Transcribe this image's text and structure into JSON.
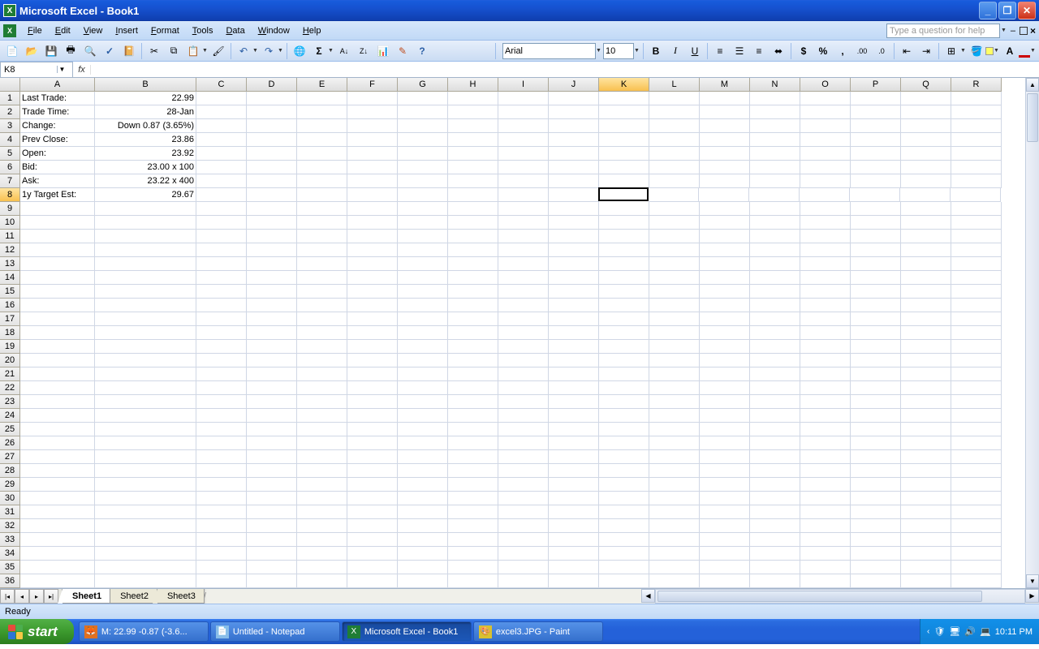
{
  "title": "Microsoft Excel - Book1",
  "menus": [
    "File",
    "Edit",
    "View",
    "Insert",
    "Format",
    "Tools",
    "Data",
    "Window",
    "Help"
  ],
  "helpbox": "Type a question for help",
  "namebox": "K8",
  "formula": "",
  "font": {
    "name": "Arial",
    "size": "10"
  },
  "columns": [
    "A",
    "B",
    "C",
    "D",
    "E",
    "F",
    "G",
    "H",
    "I",
    "J",
    "K",
    "L",
    "M",
    "N",
    "O",
    "P",
    "Q",
    "R"
  ],
  "colWidths": {
    "A": 92,
    "B": 125,
    "default": 62
  },
  "selectedCol": "K",
  "selectedRow": 8,
  "activeCell": "K8",
  "rows": [
    {
      "n": 1,
      "A": "Last Trade:",
      "B": "22.99",
      "Balign": "right"
    },
    {
      "n": 2,
      "A": "Trade Time:",
      "B": "28-Jan",
      "Balign": "right"
    },
    {
      "n": 3,
      "A": "Change:",
      "B": "Down 0.87 (3.65%)",
      "Balign": "right"
    },
    {
      "n": 4,
      "A": "Prev Close:",
      "B": "23.86",
      "Balign": "right"
    },
    {
      "n": 5,
      "A": "Open:",
      "B": "23.92",
      "Balign": "right"
    },
    {
      "n": 6,
      "A": "Bid:",
      "B": "23.00 x 100",
      "Balign": "right"
    },
    {
      "n": 7,
      "A": "Ask:",
      "B": "23.22 x 400",
      "Balign": "right"
    },
    {
      "n": 8,
      "A": "1y Target Est:",
      "B": "29.67",
      "Balign": "right"
    }
  ],
  "totalRows": 36,
  "sheets": {
    "active": "Sheet1",
    "list": [
      "Sheet1",
      "Sheet2",
      "Sheet3"
    ]
  },
  "status": "Ready",
  "taskbar": {
    "start": "start",
    "items": [
      {
        "icon": "firefox",
        "label": "M: 22.99 -0.87 (-3.6...",
        "active": false
      },
      {
        "icon": "notepad",
        "label": "Untitled - Notepad",
        "active": false
      },
      {
        "icon": "excel",
        "label": "Microsoft Excel - Book1",
        "active": true
      },
      {
        "icon": "paint",
        "label": "excel3.JPG - Paint",
        "active": false
      }
    ],
    "clock": "10:11 PM"
  }
}
